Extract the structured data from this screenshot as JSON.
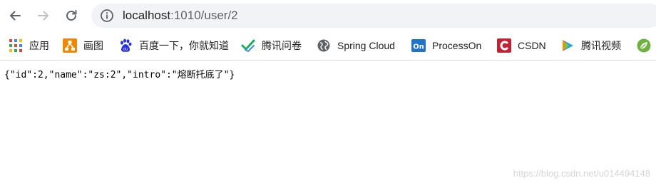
{
  "nav": {
    "back_icon": "arrow-left-icon",
    "forward_icon": "arrow-right-icon",
    "reload_icon": "reload-icon"
  },
  "omnibox": {
    "info_icon": "info-icon",
    "host": "localhost",
    "path": ":1010/user/2"
  },
  "bookmarks": [
    {
      "label": "应用",
      "icon": "apps-grid-icon"
    },
    {
      "label": "画图",
      "icon": "drawio-icon"
    },
    {
      "label": "百度一下，你就知道",
      "icon": "baidu-paw-icon"
    },
    {
      "label": "腾讯问卷",
      "icon": "tencent-survey-icon"
    },
    {
      "label": "Spring Cloud",
      "icon": "globe-icon"
    },
    {
      "label": "ProcessOn",
      "icon": "processon-icon"
    },
    {
      "label": "CSDN",
      "icon": "csdn-icon"
    },
    {
      "label": "腾讯视频",
      "icon": "tencent-video-icon"
    },
    {
      "label": "",
      "icon": "spring-leaf-icon"
    }
  ],
  "page": {
    "json_text": "{\"id\":2,\"name\":\"zs:2\",\"intro\":\"熔断托底了\"}"
  },
  "watermark": "https://blog.csdn.net/u014494148"
}
